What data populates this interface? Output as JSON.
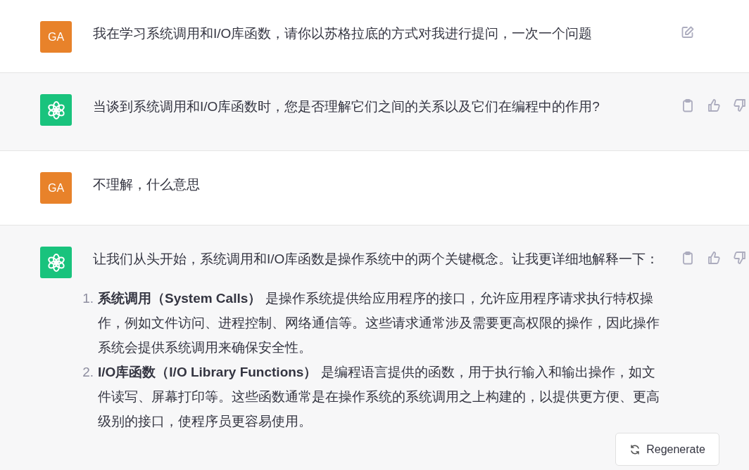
{
  "messages": [
    {
      "kind": "user",
      "avatar": "GA",
      "paragraphs": [
        "我在学习系统调用和I/O库函数，请你以苏格拉底的方式对我进行提问，一次一个问题"
      ],
      "edit_icon": true
    },
    {
      "kind": "assistant",
      "paragraphs": [
        "当谈到系统调用和I/O库函数时，您是否理解它们之间的关系以及它们在编程中的作用?"
      ]
    },
    {
      "kind": "user",
      "avatar": "GA",
      "paragraphs": [
        "不理解，什么意思"
      ],
      "edit_icon": false
    },
    {
      "kind": "assistant",
      "paragraphs": [
        "让我们从头开始，系统调用和I/O库函数是操作系统中的两个关键概念。让我更详细地解释一下："
      ],
      "list": [
        {
          "marker": "1.",
          "text": "**系统调用（System Calls）** 是操作系统提供给应用程序的接口，允许应用程序请求执行特权操作，例如文件访问、进程控制、网络通信等。这些请求通常涉及需要更高权限的操作，因此操作系统会提供系统调用来确保安全性。"
        },
        {
          "marker": "2.",
          "text": "**I/O库函数（I/O Library Functions）** 是编程语言提供的函数，用于执行输入和输出操作，如文件读写、屏幕打印等。这些函数通常是在操作系统的系统调用之上构建的，以提供更方便、更高级别的接口，使程序员更容易使用。"
        }
      ]
    }
  ],
  "regenerate_button": "Regenerate"
}
